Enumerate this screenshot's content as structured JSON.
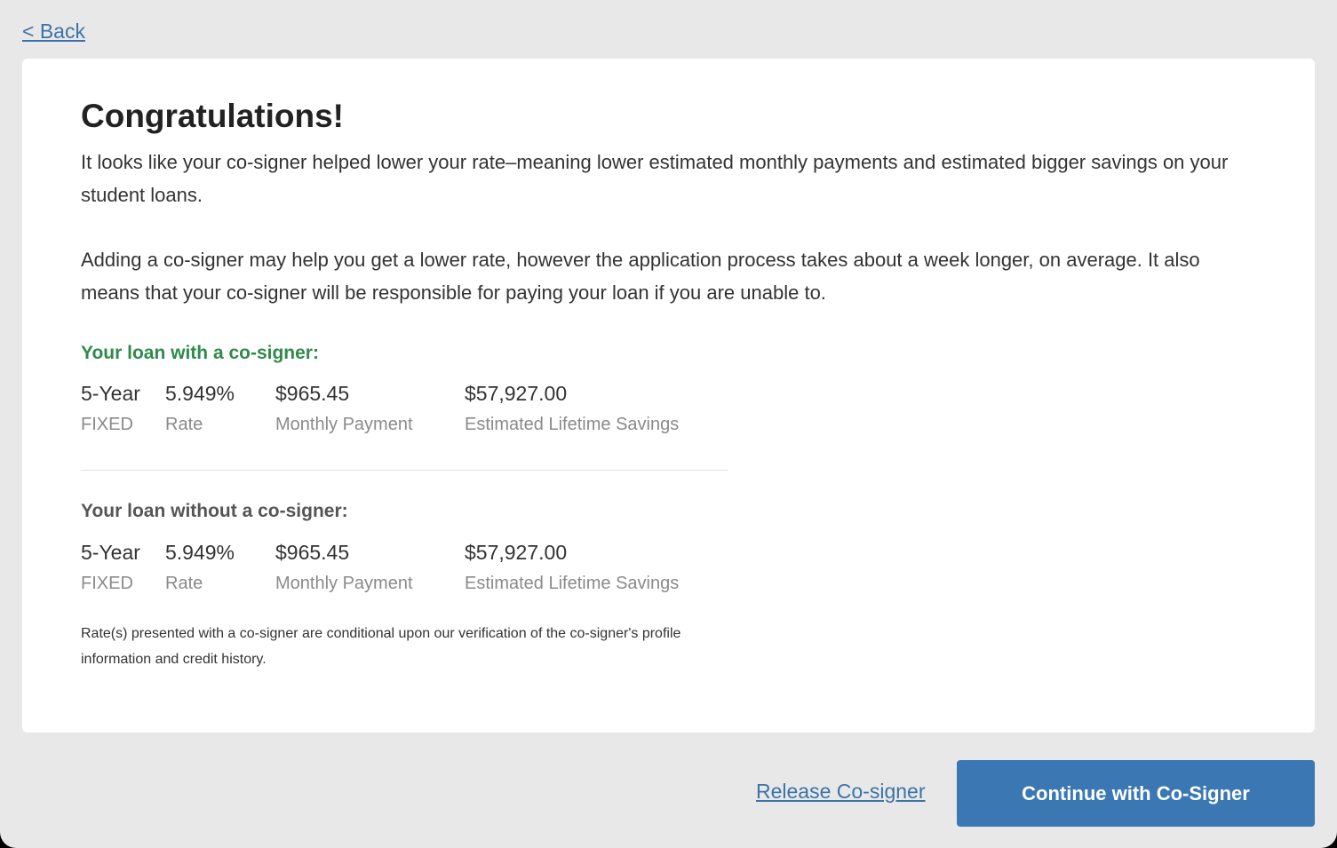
{
  "nav": {
    "back_label": "< Back"
  },
  "card": {
    "title": "Congratulations!",
    "paragraph_1": "It looks like your co-signer helped lower your rate–meaning lower estimated monthly payments and estimated bigger savings on your student loans.",
    "paragraph_2": "Adding a co-signer may help you get a lower rate, however the application process takes about a week longer, on average. It also means that your co-signer will be responsible for paying your loan if you are unable to.",
    "with_cosigner": {
      "heading": "Your loan with a co-signer:",
      "term": "5-Year",
      "term_label": "FIXED",
      "rate": "5.949%",
      "rate_label": "Rate",
      "monthly_payment": "$965.45",
      "monthly_payment_label": "Monthly Payment",
      "lifetime_savings": "$57,927.00",
      "lifetime_savings_label": "Estimated Lifetime Savings"
    },
    "without_cosigner": {
      "heading": "Your loan without a co-signer:",
      "term": "5-Year",
      "term_label": "FIXED",
      "rate": "5.949%",
      "rate_label": "Rate",
      "monthly_payment": "$965.45",
      "monthly_payment_label": "Monthly Payment",
      "lifetime_savings": "$57,927.00",
      "lifetime_savings_label": "Estimated Lifetime Savings"
    },
    "disclaimer": "Rate(s) presented with a co-signer are conditional upon our verification of the co-signer's profile information and credit history."
  },
  "actions": {
    "release_label": "Release Co-signer",
    "continue_label": "Continue with Co-Signer"
  },
  "colors": {
    "accent": "#3b77b3",
    "link": "#3c73a8",
    "success": "#2e8b4a",
    "background": "#e8e8e8"
  }
}
